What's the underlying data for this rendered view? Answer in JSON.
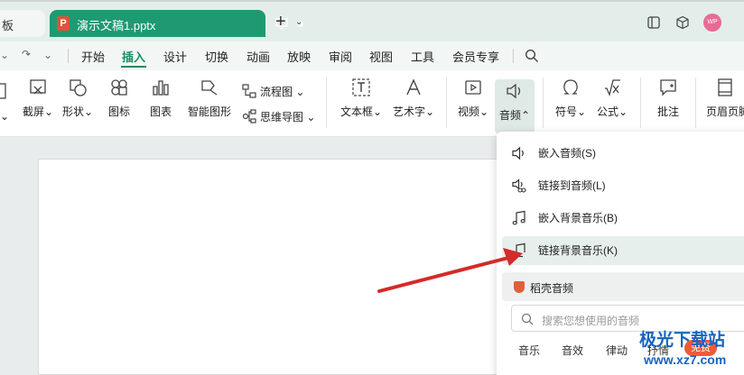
{
  "titlebar": {
    "prev_tab_label": "板",
    "active_tab_title": "演示文稿1.pptx",
    "file_badge": "P",
    "avatar_label": "WP"
  },
  "menu": {
    "items": [
      "开始",
      "插入",
      "设计",
      "切换",
      "动画",
      "放映",
      "审阅",
      "视图",
      "工具",
      "会员专享"
    ],
    "active": "插入"
  },
  "ribbon": {
    "screenshot": "截屏",
    "shape": "形状",
    "icon": "图标",
    "chart": "图表",
    "smart_shape": "智能图形",
    "flowchart": "流程图",
    "mindmap": "思维导图",
    "textbox": "文本框",
    "wordart": "艺术字",
    "video": "视频",
    "audio": "音频",
    "symbol": "符号",
    "formula": "公式",
    "comment": "批注",
    "header_footer": "页眉页脚"
  },
  "audio_menu": {
    "items": [
      "嵌入音频(S)",
      "链接到音频(L)",
      "嵌入背景音乐(B)",
      "链接背景音乐(K)"
    ],
    "section_label": "稻壳音频",
    "search_placeholder": "搜索您想使用的音频",
    "categories": [
      "音乐",
      "音效",
      "律动",
      "抒情"
    ],
    "free_badge": "免费"
  },
  "watermark": {
    "title": "极光下载站",
    "url": "www.xz7.com"
  },
  "colors": {
    "accent": "#1a8d63",
    "active_tab": "#1e9a72",
    "arrow": "#d42a2a",
    "free_badge": "#ef5b3a"
  }
}
